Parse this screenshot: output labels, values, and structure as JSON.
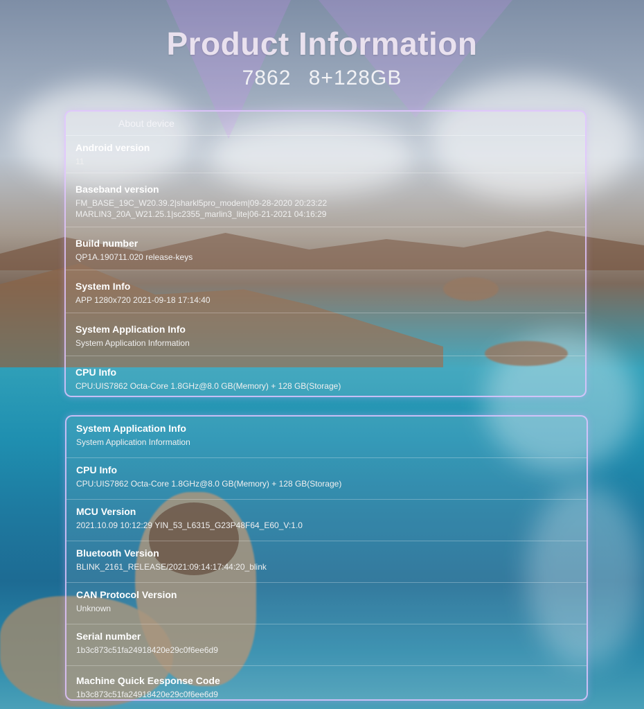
{
  "header": {
    "title": "Product Information",
    "model": "7862",
    "memory": "8+128GB"
  },
  "panel1": {
    "heading": "About device",
    "rows": [
      {
        "label": "Android version",
        "value": "11"
      },
      {
        "label": "Baseband version",
        "value": "FM_BASE_19C_W20.39.2|sharkl5pro_modem|09-28-2020 20:23:22",
        "value2": "MARLIN3_20A_W21.25.1|sc2355_marlin3_lite|06-21-2021 04:16:29"
      },
      {
        "label": "Build number",
        "value": "QP1A.190711.020 release-keys"
      },
      {
        "label": "System Info",
        "value": "APP 1280x720 2021-09-18 17:14:40"
      },
      {
        "label": "System Application Info",
        "value": "System Application Information"
      },
      {
        "label": "CPU Info",
        "value": "CPU:UIS7862 Octa-Core 1.8GHz@8.0 GB(Memory) + 128 GB(Storage)"
      }
    ]
  },
  "panel2": {
    "rows": [
      {
        "label": "System Application Info",
        "value": "System Application Information"
      },
      {
        "label": "CPU Info",
        "value": "CPU:UIS7862 Octa-Core 1.8GHz@8.0 GB(Memory) + 128 GB(Storage)"
      },
      {
        "label": "MCU Version",
        "value": "2021.10.09 10:12:29 YIN_53_L6315_G23P48F64_E60_V:1.0"
      },
      {
        "label": "Bluetooth Version",
        "value": "BLINK_2161_RELEASE/2021:09:14:17:44:20_blink"
      },
      {
        "label": "CAN Protocol Version",
        "value": "Unknown"
      },
      {
        "label": "Serial number",
        "value": "1b3c873c51fa24918420e29c0f6ee6d9"
      },
      {
        "label": "Machine Quick Eesponse Code",
        "value": "1b3c873c51fa24918420e29c0f6ee6d9"
      }
    ]
  }
}
